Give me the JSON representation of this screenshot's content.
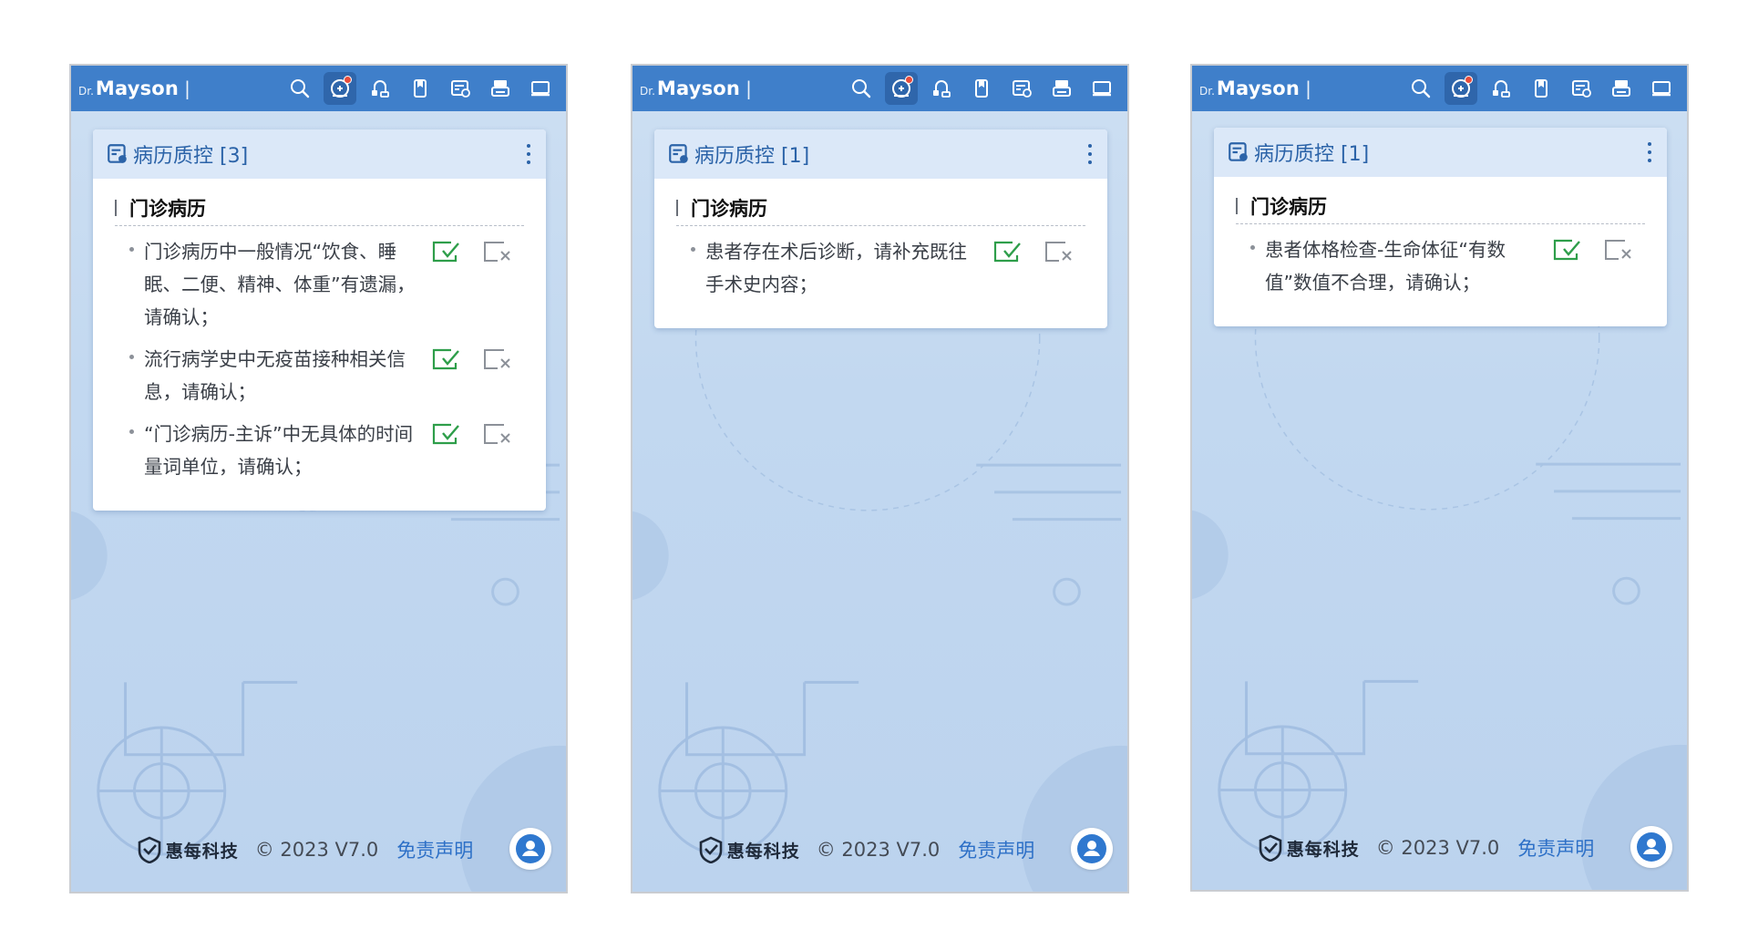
{
  "brand": {
    "prefix": "Dr.",
    "name": "Mayson",
    "separator": "|"
  },
  "toolbar": [
    "search-icon",
    "doctor-alert-icon",
    "consult-icon",
    "document-icon",
    "card-check-icon",
    "printer-icon",
    "monitor-icon"
  ],
  "footer": {
    "logo_text": "惠每科技",
    "copyright": "© 2023 V7.0",
    "disclaimer": "免责声明"
  },
  "colors": {
    "header": "#3f7fca",
    "accent": "#2b63a8",
    "confirm": "#2e9e4a",
    "dismiss": "#8c9199",
    "alert_dot": "#e74c3c"
  },
  "panels": [
    {
      "card_title": "病历质控 [3]",
      "section_title": "门诊病历",
      "items": [
        {
          "text": "门诊病历中一般情况“饮食、睡眠、二便、精神、体重”有遗漏，请确认；"
        },
        {
          "text": "流行病学史中无疫苗接种相关信息，请确认；"
        },
        {
          "text": "“门诊病历-主诉”中无具体的时间量词单位，请确认；"
        }
      ]
    },
    {
      "card_title": "病历质控 [1]",
      "section_title": "门诊病历",
      "items": [
        {
          "text": "患者存在术后诊断，请补充既往手术史内容；"
        }
      ]
    },
    {
      "card_title": "病历质控 [1]",
      "section_title": "门诊病历",
      "items": [
        {
          "text": "患者体格检查-生命体征“有数值”数值不合理，请确认；"
        }
      ]
    }
  ]
}
